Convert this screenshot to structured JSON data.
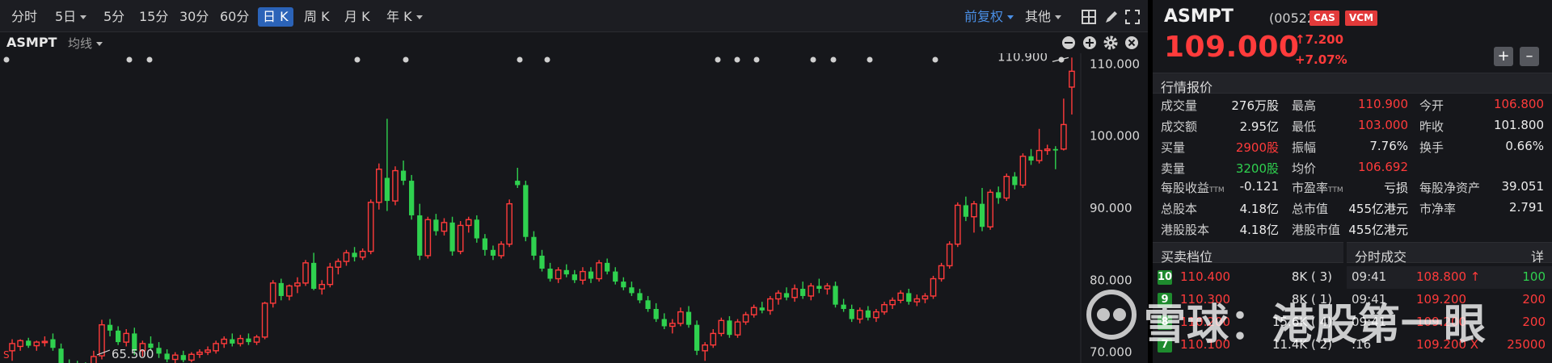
{
  "toolbar": {
    "periods": [
      "分时",
      "5日",
      "5分",
      "15分",
      "30分",
      "60分",
      "日 K",
      "周 K",
      "月 K",
      "年 K"
    ],
    "active_period": "日 K",
    "adjust_label": "前复权",
    "other_label": "其他"
  },
  "chart_header": {
    "stock_name": "ASMPT",
    "indicator_label": "均线"
  },
  "chart_data": {
    "type": "candlestick",
    "ylim": [
      68.5,
      111.5
    ],
    "yticks": [
      "110.000",
      "100.000",
      "90.000",
      "80.000",
      "70.000"
    ],
    "high_annotation": "110.900",
    "low_annotation": "65.500",
    "corner_label": "S",
    "candles": [
      {
        "o": 70.2,
        "h": 71.8,
        "l": 68.8,
        "c": 71.2,
        "up": true
      },
      {
        "o": 70.8,
        "h": 71.8,
        "l": 70.2,
        "c": 71.6,
        "up": true
      },
      {
        "o": 71.6,
        "h": 72.0,
        "l": 70.6,
        "c": 70.9,
        "up": false
      },
      {
        "o": 70.9,
        "h": 71.6,
        "l": 70.2,
        "c": 71.4,
        "up": true
      },
      {
        "o": 71.4,
        "h": 72.2,
        "l": 70.8,
        "c": 71.5,
        "up": true
      },
      {
        "o": 71.8,
        "h": 72.6,
        "l": 70.2,
        "c": 70.6,
        "up": false
      },
      {
        "o": 70.5,
        "h": 71.2,
        "l": 67.8,
        "c": 68.4,
        "up": false
      },
      {
        "o": 68.3,
        "h": 69.0,
        "l": 67.6,
        "c": 68.0,
        "up": false
      },
      {
        "o": 68.0,
        "h": 68.8,
        "l": 67.2,
        "c": 67.6,
        "up": false
      },
      {
        "o": 67.6,
        "h": 68.6,
        "l": 66.5,
        "c": 67.3,
        "up": false
      },
      {
        "o": 67.3,
        "h": 70.2,
        "l": 66.2,
        "c": 69.4,
        "up": true
      },
      {
        "o": 69.5,
        "h": 74.5,
        "l": 69.0,
        "c": 73.8,
        "up": true
      },
      {
        "o": 73.8,
        "h": 74.6,
        "l": 72.2,
        "c": 73.0,
        "up": false
      },
      {
        "o": 73.0,
        "h": 73.6,
        "l": 71.0,
        "c": 71.4,
        "up": false
      },
      {
        "o": 71.4,
        "h": 73.2,
        "l": 70.8,
        "c": 72.6,
        "up": true
      },
      {
        "o": 72.6,
        "h": 73.4,
        "l": 69.6,
        "c": 70.2,
        "up": false
      },
      {
        "o": 70.2,
        "h": 71.6,
        "l": 69.4,
        "c": 71.2,
        "up": true
      },
      {
        "o": 71.2,
        "h": 72.2,
        "l": 70.2,
        "c": 70.6,
        "up": false
      },
      {
        "o": 70.6,
        "h": 71.4,
        "l": 69.2,
        "c": 69.8,
        "up": false
      },
      {
        "o": 69.8,
        "h": 70.4,
        "l": 68.6,
        "c": 69.0,
        "up": false
      },
      {
        "o": 69.0,
        "h": 70.0,
        "l": 68.4,
        "c": 69.6,
        "up": true
      },
      {
        "o": 69.6,
        "h": 70.2,
        "l": 68.6,
        "c": 68.9,
        "up": false
      },
      {
        "o": 68.9,
        "h": 70.0,
        "l": 68.6,
        "c": 69.7,
        "up": true
      },
      {
        "o": 69.7,
        "h": 70.4,
        "l": 69.2,
        "c": 70.0,
        "up": true
      },
      {
        "o": 70.0,
        "h": 70.8,
        "l": 69.6,
        "c": 70.3,
        "up": true
      },
      {
        "o": 70.2,
        "h": 71.6,
        "l": 69.8,
        "c": 71.2,
        "up": true
      },
      {
        "o": 71.2,
        "h": 72.2,
        "l": 70.6,
        "c": 71.8,
        "up": true
      },
      {
        "o": 71.8,
        "h": 72.6,
        "l": 70.8,
        "c": 71.2,
        "up": false
      },
      {
        "o": 71.2,
        "h": 72.4,
        "l": 70.8,
        "c": 71.9,
        "up": true
      },
      {
        "o": 71.9,
        "h": 72.6,
        "l": 71.0,
        "c": 71.4,
        "up": false
      },
      {
        "o": 71.4,
        "h": 72.4,
        "l": 71.0,
        "c": 72.1,
        "up": true
      },
      {
        "o": 72.1,
        "h": 77.0,
        "l": 71.8,
        "c": 76.8,
        "up": true
      },
      {
        "o": 76.8,
        "h": 80.0,
        "l": 76.2,
        "c": 79.6,
        "up": true
      },
      {
        "o": 79.6,
        "h": 80.2,
        "l": 77.2,
        "c": 77.8,
        "up": false
      },
      {
        "o": 77.8,
        "h": 79.4,
        "l": 77.2,
        "c": 79.2,
        "up": true
      },
      {
        "o": 79.2,
        "h": 80.4,
        "l": 78.2,
        "c": 79.6,
        "up": true
      },
      {
        "o": 79.6,
        "h": 82.8,
        "l": 79.2,
        "c": 82.4,
        "up": true
      },
      {
        "o": 82.4,
        "h": 83.8,
        "l": 78.6,
        "c": 78.8,
        "up": false
      },
      {
        "o": 78.8,
        "h": 80.0,
        "l": 78.0,
        "c": 79.4,
        "up": true
      },
      {
        "o": 79.4,
        "h": 82.4,
        "l": 79.0,
        "c": 81.8,
        "up": true
      },
      {
        "o": 81.8,
        "h": 83.0,
        "l": 80.8,
        "c": 82.6,
        "up": true
      },
      {
        "o": 82.6,
        "h": 84.2,
        "l": 82.0,
        "c": 83.8,
        "up": true
      },
      {
        "o": 83.8,
        "h": 84.6,
        "l": 82.6,
        "c": 83.2,
        "up": false
      },
      {
        "o": 83.2,
        "h": 84.4,
        "l": 82.8,
        "c": 84.0,
        "up": true
      },
      {
        "o": 84.0,
        "h": 91.2,
        "l": 83.6,
        "c": 90.8,
        "up": true
      },
      {
        "o": 90.8,
        "h": 96.2,
        "l": 89.8,
        "c": 95.4,
        "up": true
      },
      {
        "o": 94.2,
        "h": 102.4,
        "l": 89.6,
        "c": 91.0,
        "up": false
      },
      {
        "o": 91.0,
        "h": 95.8,
        "l": 90.4,
        "c": 95.2,
        "up": true
      },
      {
        "o": 95.2,
        "h": 96.6,
        "l": 93.2,
        "c": 93.8,
        "up": false
      },
      {
        "o": 93.8,
        "h": 94.6,
        "l": 88.4,
        "c": 89.0,
        "up": false
      },
      {
        "o": 89.0,
        "h": 90.6,
        "l": 82.8,
        "c": 83.4,
        "up": false
      },
      {
        "o": 83.4,
        "h": 88.8,
        "l": 83.0,
        "c": 88.4,
        "up": true
      },
      {
        "o": 88.4,
        "h": 89.2,
        "l": 86.2,
        "c": 86.8,
        "up": false
      },
      {
        "o": 86.8,
        "h": 88.6,
        "l": 86.2,
        "c": 88.0,
        "up": true
      },
      {
        "o": 88.0,
        "h": 88.8,
        "l": 83.4,
        "c": 84.0,
        "up": false
      },
      {
        "o": 84.0,
        "h": 88.2,
        "l": 83.6,
        "c": 87.6,
        "up": true
      },
      {
        "o": 87.6,
        "h": 88.8,
        "l": 86.6,
        "c": 88.4,
        "up": true
      },
      {
        "o": 88.4,
        "h": 89.0,
        "l": 85.2,
        "c": 85.8,
        "up": false
      },
      {
        "o": 85.8,
        "h": 86.4,
        "l": 83.4,
        "c": 84.2,
        "up": false
      },
      {
        "o": 84.2,
        "h": 84.8,
        "l": 82.8,
        "c": 83.4,
        "up": false
      },
      {
        "o": 83.4,
        "h": 85.4,
        "l": 83.0,
        "c": 85.0,
        "up": true
      },
      {
        "o": 85.0,
        "h": 91.2,
        "l": 84.6,
        "c": 90.6,
        "up": true
      },
      {
        "o": 93.8,
        "h": 95.6,
        "l": 92.8,
        "c": 93.2,
        "up": false
      },
      {
        "o": 93.2,
        "h": 93.8,
        "l": 85.4,
        "c": 86.0,
        "up": false
      },
      {
        "o": 86.0,
        "h": 86.8,
        "l": 82.8,
        "c": 83.4,
        "up": false
      },
      {
        "o": 83.4,
        "h": 84.2,
        "l": 81.2,
        "c": 81.6,
        "up": false
      },
      {
        "o": 81.6,
        "h": 82.4,
        "l": 79.8,
        "c": 80.2,
        "up": false
      },
      {
        "o": 80.2,
        "h": 81.8,
        "l": 79.6,
        "c": 81.4,
        "up": true
      },
      {
        "o": 81.4,
        "h": 82.2,
        "l": 80.4,
        "c": 80.8,
        "up": false
      },
      {
        "o": 80.8,
        "h": 81.4,
        "l": 79.6,
        "c": 80.0,
        "up": false
      },
      {
        "o": 80.0,
        "h": 81.8,
        "l": 79.4,
        "c": 81.2,
        "up": true
      },
      {
        "o": 81.2,
        "h": 81.8,
        "l": 79.6,
        "c": 80.2,
        "up": false
      },
      {
        "o": 80.2,
        "h": 82.8,
        "l": 79.8,
        "c": 82.4,
        "up": true
      },
      {
        "o": 82.4,
        "h": 83.0,
        "l": 80.8,
        "c": 81.2,
        "up": false
      },
      {
        "o": 81.2,
        "h": 81.8,
        "l": 79.4,
        "c": 79.8,
        "up": false
      },
      {
        "o": 79.8,
        "h": 80.4,
        "l": 78.6,
        "c": 79.0,
        "up": false
      },
      {
        "o": 79.0,
        "h": 79.8,
        "l": 77.8,
        "c": 78.2,
        "up": false
      },
      {
        "o": 78.2,
        "h": 78.8,
        "l": 76.8,
        "c": 77.2,
        "up": false
      },
      {
        "o": 77.2,
        "h": 77.8,
        "l": 75.6,
        "c": 76.0,
        "up": false
      },
      {
        "o": 76.0,
        "h": 76.8,
        "l": 74.2,
        "c": 74.6,
        "up": false
      },
      {
        "o": 74.6,
        "h": 75.4,
        "l": 73.2,
        "c": 73.6,
        "up": false
      },
      {
        "o": 73.6,
        "h": 74.6,
        "l": 72.6,
        "c": 74.0,
        "up": true
      },
      {
        "o": 74.0,
        "h": 76.2,
        "l": 73.6,
        "c": 75.6,
        "up": true
      },
      {
        "o": 75.6,
        "h": 76.4,
        "l": 73.4,
        "c": 73.8,
        "up": false
      },
      {
        "o": 73.8,
        "h": 74.4,
        "l": 69.6,
        "c": 70.2,
        "up": false
      },
      {
        "o": 70.2,
        "h": 71.4,
        "l": 68.8,
        "c": 71.0,
        "up": true
      },
      {
        "o": 71.0,
        "h": 73.2,
        "l": 70.6,
        "c": 72.6,
        "up": true
      },
      {
        "o": 72.6,
        "h": 74.8,
        "l": 72.2,
        "c": 74.4,
        "up": true
      },
      {
        "o": 74.4,
        "h": 75.0,
        "l": 72.0,
        "c": 72.4,
        "up": false
      },
      {
        "o": 72.4,
        "h": 74.6,
        "l": 72.0,
        "c": 74.2,
        "up": true
      },
      {
        "o": 74.2,
        "h": 75.6,
        "l": 73.8,
        "c": 75.2,
        "up": true
      },
      {
        "o": 75.2,
        "h": 76.6,
        "l": 74.8,
        "c": 76.2,
        "up": true
      },
      {
        "o": 76.2,
        "h": 77.0,
        "l": 75.4,
        "c": 75.8,
        "up": false
      },
      {
        "o": 75.8,
        "h": 77.8,
        "l": 75.2,
        "c": 77.4,
        "up": true
      },
      {
        "o": 77.4,
        "h": 78.6,
        "l": 76.6,
        "c": 78.2,
        "up": true
      },
      {
        "o": 78.2,
        "h": 79.0,
        "l": 77.2,
        "c": 77.6,
        "up": false
      },
      {
        "o": 77.6,
        "h": 79.4,
        "l": 77.0,
        "c": 78.8,
        "up": true
      },
      {
        "o": 78.8,
        "h": 79.8,
        "l": 77.4,
        "c": 77.8,
        "up": false
      },
      {
        "o": 77.8,
        "h": 79.6,
        "l": 77.2,
        "c": 79.2,
        "up": true
      },
      {
        "o": 79.2,
        "h": 80.2,
        "l": 78.2,
        "c": 78.8,
        "up": false
      },
      {
        "o": 78.8,
        "h": 79.6,
        "l": 78.0,
        "c": 79.2,
        "up": true
      },
      {
        "o": 79.2,
        "h": 79.8,
        "l": 76.2,
        "c": 76.6,
        "up": false
      },
      {
        "o": 76.6,
        "h": 77.4,
        "l": 75.6,
        "c": 76.0,
        "up": false
      },
      {
        "o": 76.0,
        "h": 76.6,
        "l": 74.2,
        "c": 74.6,
        "up": false
      },
      {
        "o": 74.6,
        "h": 76.2,
        "l": 74.0,
        "c": 75.8,
        "up": true
      },
      {
        "o": 75.8,
        "h": 76.4,
        "l": 74.4,
        "c": 74.8,
        "up": false
      },
      {
        "o": 74.8,
        "h": 76.0,
        "l": 74.2,
        "c": 75.6,
        "up": true
      },
      {
        "o": 75.6,
        "h": 77.0,
        "l": 75.2,
        "c": 76.6,
        "up": true
      },
      {
        "o": 76.6,
        "h": 77.6,
        "l": 76.0,
        "c": 77.2,
        "up": true
      },
      {
        "o": 77.2,
        "h": 78.6,
        "l": 76.8,
        "c": 78.2,
        "up": true
      },
      {
        "o": 78.2,
        "h": 78.8,
        "l": 76.6,
        "c": 77.0,
        "up": false
      },
      {
        "o": 77.0,
        "h": 78.0,
        "l": 76.4,
        "c": 77.4,
        "up": true
      },
      {
        "o": 77.4,
        "h": 78.2,
        "l": 76.8,
        "c": 77.8,
        "up": true
      },
      {
        "o": 77.8,
        "h": 80.6,
        "l": 77.4,
        "c": 80.2,
        "up": true
      },
      {
        "o": 80.2,
        "h": 82.4,
        "l": 79.8,
        "c": 82.0,
        "up": true
      },
      {
        "o": 82.0,
        "h": 85.4,
        "l": 81.6,
        "c": 85.0,
        "up": true
      },
      {
        "o": 85.0,
        "h": 90.8,
        "l": 84.6,
        "c": 90.4,
        "up": true
      },
      {
        "o": 90.4,
        "h": 91.6,
        "l": 88.2,
        "c": 88.8,
        "up": false
      },
      {
        "o": 88.8,
        "h": 91.0,
        "l": 86.6,
        "c": 90.6,
        "up": true
      },
      {
        "o": 90.6,
        "h": 92.8,
        "l": 86.8,
        "c": 87.4,
        "up": false
      },
      {
        "o": 87.4,
        "h": 92.6,
        "l": 87.0,
        "c": 92.2,
        "up": true
      },
      {
        "o": 92.2,
        "h": 93.0,
        "l": 90.6,
        "c": 91.4,
        "up": false
      },
      {
        "o": 91.4,
        "h": 94.8,
        "l": 91.0,
        "c": 94.4,
        "up": true
      },
      {
        "o": 94.4,
        "h": 95.0,
        "l": 92.6,
        "c": 93.2,
        "up": false
      },
      {
        "o": 93.2,
        "h": 97.6,
        "l": 92.8,
        "c": 97.2,
        "up": true
      },
      {
        "o": 97.2,
        "h": 98.2,
        "l": 96.0,
        "c": 96.6,
        "up": false
      },
      {
        "o": 96.6,
        "h": 101.0,
        "l": 96.2,
        "c": 98.0,
        "up": true
      },
      {
        "o": 98.0,
        "h": 98.8,
        "l": 97.4,
        "c": 98.2,
        "up": true
      },
      {
        "o": 98.2,
        "h": 98.6,
        "l": 95.4,
        "c": 98.0,
        "up": false
      },
      {
        "o": 98.2,
        "h": 105.2,
        "l": 98.0,
        "c": 101.6,
        "up": true
      },
      {
        "o": 106.8,
        "h": 110.9,
        "l": 103.0,
        "c": 109.0,
        "up": true
      }
    ]
  },
  "quote": {
    "name": "ASMPT",
    "code": "(00522)",
    "tags": [
      "CAS",
      "VCM"
    ],
    "price": "109.000",
    "change": "7.200",
    "change_pct": "+7.07%",
    "section_title": "行情报价",
    "rows": [
      {
        "l1": "成交量",
        "v1": "276万股",
        "l2": "最高",
        "v2": "110.900",
        "l3": "今开",
        "v3": "106.800"
      },
      {
        "l1": "成交额",
        "v1": "2.95亿",
        "l2": "最低",
        "v2": "103.000",
        "l3": "昨收",
        "v3": "101.800"
      },
      {
        "l1": "买量",
        "v1": "2900股",
        "l2": "振幅",
        "v2": "7.76%",
        "l3": "换手",
        "v3": "0.66%"
      },
      {
        "l1": "卖量",
        "v1": "3200股",
        "l2": "均价",
        "v2": "106.692",
        "l3": "",
        "v3": ""
      }
    ],
    "fund_rows": [
      {
        "l1": "每股收益",
        "v1": "-0.121",
        "l2": "市盈率",
        "v2": "亏损",
        "l3": "每股净资产",
        "v3": "39.051"
      },
      {
        "l1": "总股本",
        "v1": "4.18亿",
        "l2": "总市值",
        "v2": "455亿港元",
        "l3": "市净率",
        "v3": "2.791"
      },
      {
        "l1": "港股股本",
        "v1": "4.18亿",
        "l2": "港股市值",
        "v2": "455亿港元",
        "l3": "",
        "v3": ""
      }
    ],
    "ttm": "TTM"
  },
  "orderbook": {
    "title": "买卖档位",
    "rows": [
      {
        "level": "10",
        "price": "110.400",
        "vol": "8K (",
        "cnt": "3)"
      },
      {
        "level": "9",
        "price": "110.300",
        "vol": "8K (",
        "cnt": "1)"
      },
      {
        "level": "8",
        "price": "110.200",
        "vol": "15.6K (",
        "cnt": "4)"
      },
      {
        "level": "7",
        "price": "110.100",
        "vol": "11.4K (",
        "cnt": "2)"
      }
    ]
  },
  "ticks": {
    "title": "分时成交",
    "detail_label": "详",
    "rows": [
      {
        "time": "09:41",
        "price": "108.800",
        "dir": "↑",
        "vol": "100",
        "vol_color": "green"
      },
      {
        "time": "09:41",
        "price": "109.200",
        "dir": "",
        "vol": "200",
        "vol_color": "red"
      },
      {
        "time": "09:41",
        "price": "109.200",
        "dir": "",
        "vol": "200",
        "vol_color": "red"
      },
      {
        "time": ":16",
        "price": "109.200",
        "dir": "X",
        "vol": "25000",
        "vol_color": "red"
      }
    ]
  },
  "watermark": "雪球：港股第一眼",
  "colors": {
    "up": "#ff3b3b",
    "down": "#2fd14f",
    "accent": "#2b63b8"
  }
}
